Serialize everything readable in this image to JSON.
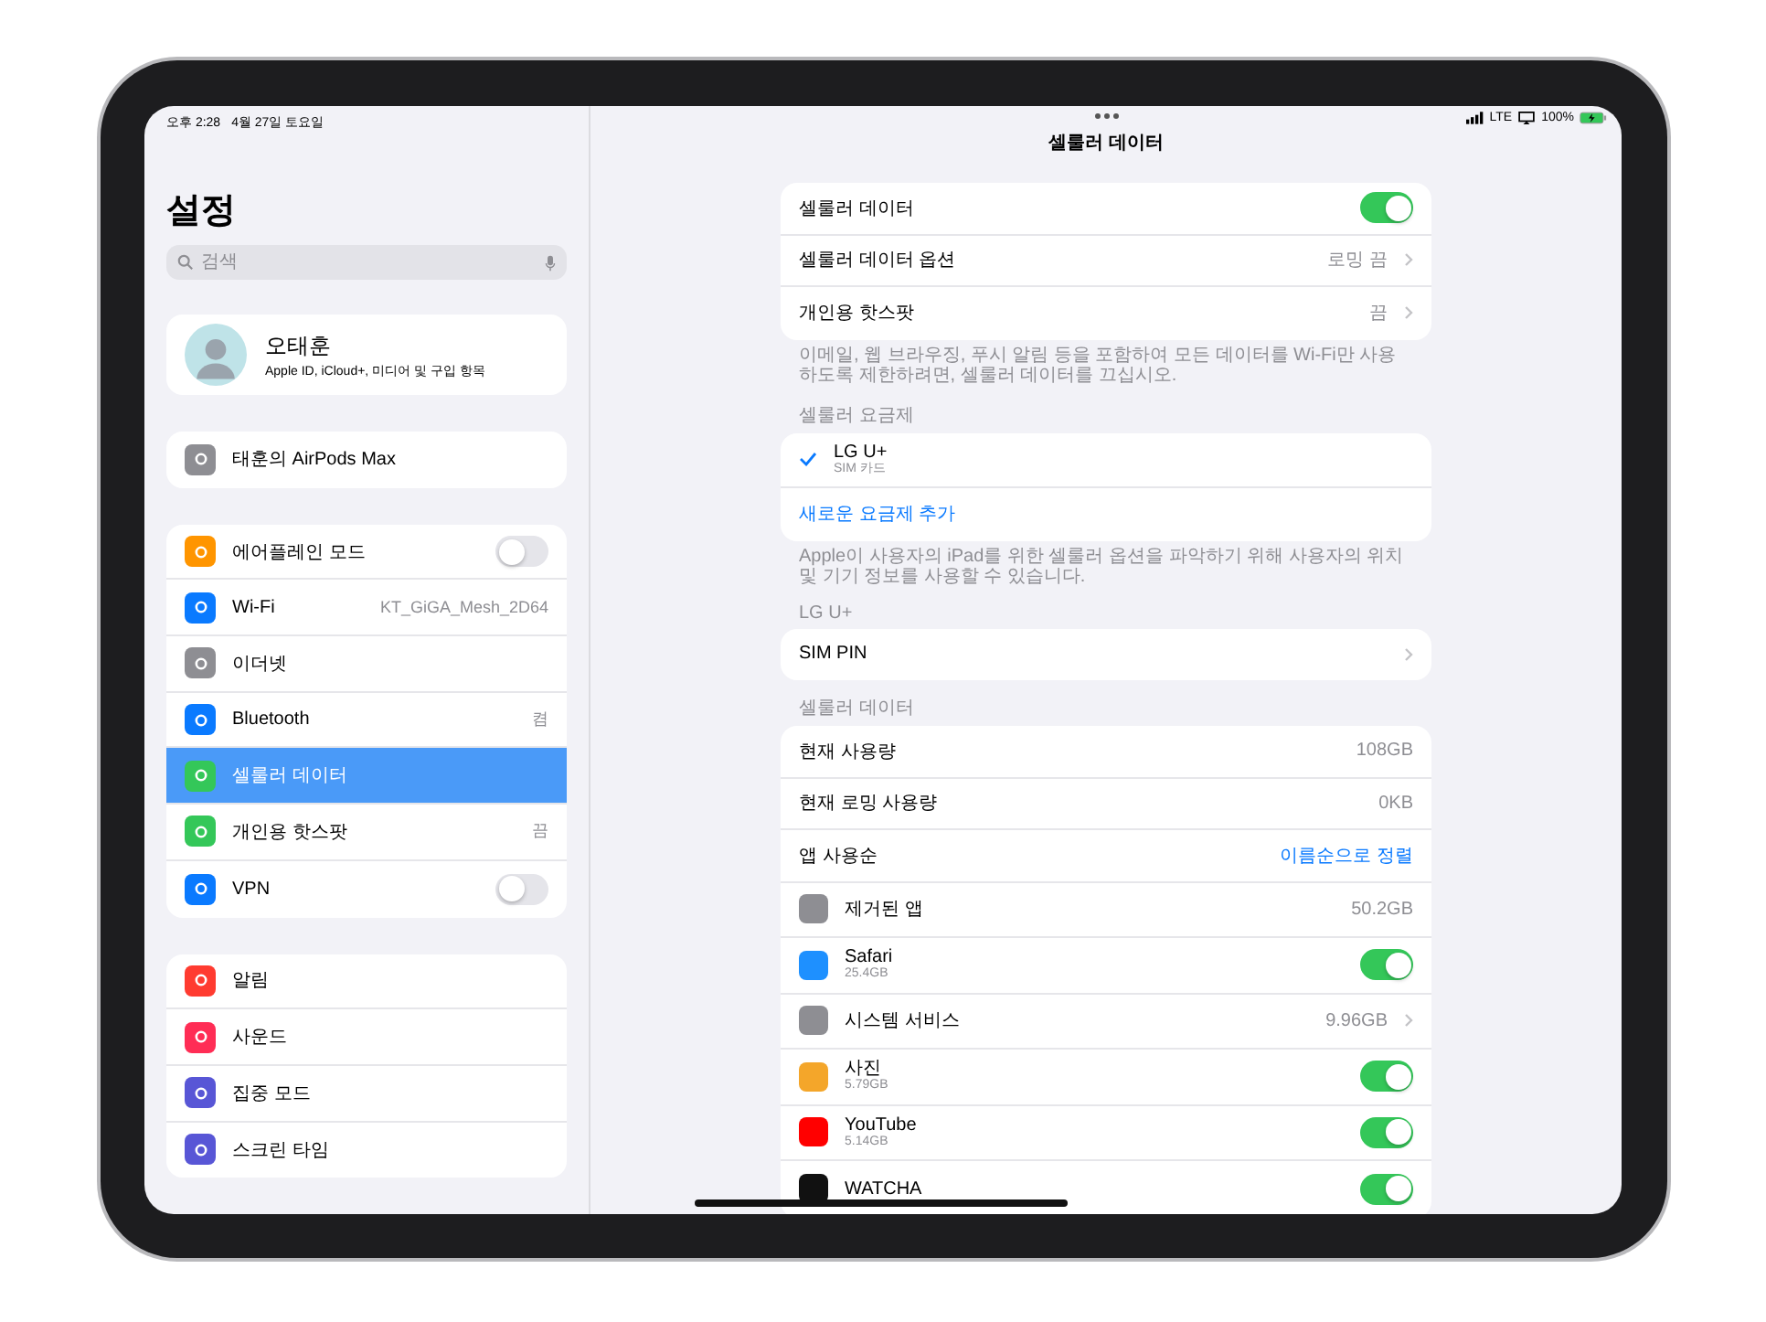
{
  "status_bar": {
    "time": "오후 2:28",
    "date": "4월 27일 토요일",
    "network": "LTE",
    "battery": "100%"
  },
  "sidebar": {
    "title": "설정",
    "search": {
      "placeholder": "검색"
    },
    "profile": {
      "name": "오태훈",
      "subtitle": "Apple ID, iCloud+, 미디어 및 구입 항목"
    },
    "groups": [
      [
        {
          "label": "태훈의 AirPods Max",
          "kind": "plain",
          "color": "#8e8e93",
          "selected": false
        }
      ],
      [
        {
          "label": "에어플레인 모드",
          "kind": "toggle",
          "on": false,
          "color": "#ff9500",
          "selected": false
        },
        {
          "label": "Wi-Fi",
          "kind": "value",
          "value": "KT_GiGA_Mesh_2D64",
          "color": "#0a7aff",
          "selected": false
        },
        {
          "label": "이더넷",
          "kind": "plain",
          "color": "#8e8e93",
          "selected": false
        },
        {
          "label": "Bluetooth",
          "kind": "value",
          "value": "켬",
          "color": "#0a7aff",
          "selected": false
        },
        {
          "label": "셀룰러 데이터",
          "kind": "plain",
          "color": "#34c759",
          "selected": true
        },
        {
          "label": "개인용 핫스팟",
          "kind": "value",
          "value": "끔",
          "color": "#34c759",
          "selected": false
        },
        {
          "label": "VPN",
          "kind": "toggle",
          "on": false,
          "color": "#0a7aff",
          "selected": false
        }
      ],
      [
        {
          "label": "알림",
          "kind": "plain",
          "color": "#ff3b30",
          "selected": false
        },
        {
          "label": "사운드",
          "kind": "plain",
          "color": "#ff2d55",
          "selected": false
        },
        {
          "label": "집중 모드",
          "kind": "plain",
          "color": "#5856d6",
          "selected": false
        },
        {
          "label": "스크린 타임",
          "kind": "plain",
          "color": "#5856d6",
          "selected": false
        }
      ]
    ]
  },
  "detail": {
    "title": "셀룰러 데이터",
    "sections": [
      {
        "rows": [
          {
            "kind": "toggle",
            "label": "셀룰러 데이터",
            "on": true
          },
          {
            "kind": "disclosure",
            "label": "셀룰러 데이터 옵션",
            "value": "로밍 끔"
          },
          {
            "kind": "disclosure",
            "label": "개인용 핫스팟",
            "value": "끔"
          }
        ],
        "footer": "이메일, 웹 브라우징, 푸시 알림 등을 포함하여 모든 데이터를 Wi-Fi만 사용하도록 제한하려면, 셀룰러 데이터를 끄십시오."
      },
      {
        "header": "셀룰러 요금제",
        "rows": [
          {
            "kind": "plan",
            "label": "LG U+",
            "sub": "SIM 카드",
            "selected": true
          },
          {
            "kind": "link",
            "label": "새로운 요금제 추가"
          }
        ],
        "footer": "Apple이 사용자의 iPad를 위한 셀룰러 옵션을 파악하기 위해 사용자의 위치 및 기기 정보를 사용할 수 있습니다."
      },
      {
        "header": "LG U+",
        "rows": [
          {
            "kind": "disclosure",
            "label": "SIM PIN"
          }
        ]
      },
      {
        "header": "셀룰러 데이터",
        "rows": [
          {
            "kind": "value",
            "label": "현재 사용량",
            "value": "108GB"
          },
          {
            "kind": "value",
            "label": "현재 로밍 사용량",
            "value": "0KB"
          },
          {
            "kind": "sort",
            "label": "앱 사용순",
            "value": "이름순으로 정렬"
          },
          {
            "kind": "app",
            "label": "제거된 앱",
            "value": "50.2GB",
            "color": "#8e8e93"
          },
          {
            "kind": "app",
            "label": "Safari",
            "sub": "25.4GB",
            "on": true,
            "color": "#1e90ff"
          },
          {
            "kind": "app",
            "label": "시스템 서비스",
            "value": "9.96GB",
            "chevron": true,
            "color": "#8e8e93"
          },
          {
            "kind": "app",
            "label": "사진",
            "sub": "5.79GB",
            "on": true,
            "color": "#f4a62a"
          },
          {
            "kind": "app",
            "label": "YouTube",
            "sub": "5.14GB",
            "on": true,
            "color": "#ff0000"
          },
          {
            "kind": "app",
            "label": "WATCHA",
            "on": true,
            "color": "#111111"
          }
        ]
      }
    ]
  }
}
